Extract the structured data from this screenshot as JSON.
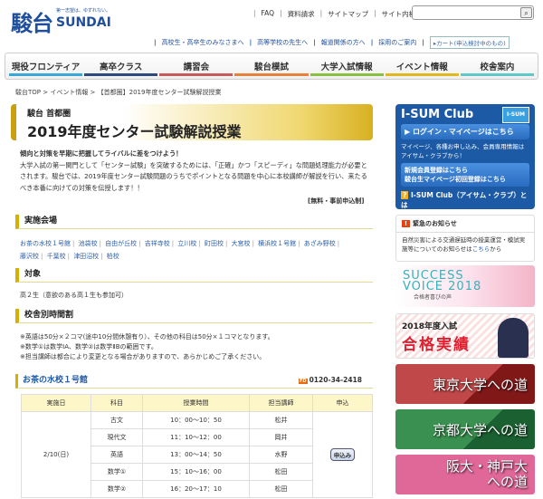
{
  "header": {
    "logo_kanji": "駿台",
    "logo_en": "SUNDAI",
    "tagline": "第一志望は、ゆずれない。",
    "top_links": [
      "FAQ",
      "資料請求",
      "サイトマップ"
    ],
    "search_label": "サイト内検索：",
    "search_value": "",
    "sub_links": [
      "高校生・高卒生のみなさまへ",
      "高等学校の先生へ",
      "報道関係の方へ",
      "採用のご案内"
    ],
    "cart": "▸カート(申込検討中のもの)"
  },
  "nav": [
    {
      "label": "現役フロンティア",
      "color": "#3ba7d8"
    },
    {
      "label": "高卒クラス",
      "color": "#2e4a7d"
    },
    {
      "label": "講習会",
      "color": "#c85a5a"
    },
    {
      "label": "駿台模試",
      "color": "#e8823a"
    },
    {
      "label": "大学入試情報",
      "color": "#8ac040"
    },
    {
      "label": "イベント情報",
      "color": "#e0b820"
    },
    {
      "label": "校舎案内",
      "color": "#5cc8c8"
    }
  ],
  "breadcrumb": "駿台TOP > イベント情報 > 【首都圏】2019年度センター試験解説授業",
  "title": {
    "sub": "駿台 首都圏",
    "main": "2019年度センター試験解説授業"
  },
  "intro": {
    "lead": "傾向と対策を早期に把握してライバルに差をつけよう！",
    "body": "大学入試の第一関門として「センター試験」を突破するためには、「正確」かつ「スピーディ」な問題処理能力が必要とされます。駿台では、2019年度センター試験問題のうちでポイントとなる問題を中心に本校講師が解説を行い、来たるべき本番に向けての対策を伝授します！！",
    "note": "[無料・事前申込制]"
  },
  "venues": {
    "heading": "実施会場",
    "items": [
      "お茶の水校１号館",
      "池袋校",
      "自由が丘校",
      "吉祥寺校",
      "立川校",
      "町田校",
      "大宮校",
      "横浜校１号館",
      "あざみ野校",
      "藤沢校",
      "千葉校",
      "津田沼校",
      "柏校"
    ]
  },
  "target": {
    "heading": "対象",
    "text": "高２生（意欲のある高１生も参加可）"
  },
  "schedule": {
    "heading": "校舎別時間割",
    "notes": [
      "※英語は50分×２コマ(途中10分間休憩有り）、その他の科目は50分×１コマとなります。",
      "※数学①は数学ⅠA、数学②は数学ⅡBの範囲です。",
      "※担当講師は都合により変更となる場合がありますので、あらかじめご了承ください。"
    ]
  },
  "campus": {
    "name": "お茶の水校１号館",
    "tel_icon": "FD",
    "tel": "0120-34-2418",
    "columns": [
      "実施日",
      "科目",
      "授業時間",
      "担当講師",
      "申込"
    ],
    "date": "2/10(日)",
    "apply": "申込み",
    "rows": [
      {
        "subject": "古文",
        "time": "10：00～10：50",
        "teacher": "松井"
      },
      {
        "subject": "現代文",
        "time": "11：10～12：00",
        "teacher": "岡井"
      },
      {
        "subject": "英語",
        "time": "13：00～14：50",
        "teacher": "水野"
      },
      {
        "subject": "数学①",
        "time": "15：10～16：00",
        "teacher": "松田"
      },
      {
        "subject": "数学②",
        "time": "16：20～17：10",
        "teacher": "松田"
      }
    ]
  },
  "sidebar": {
    "isum_title": "I-SUM Club",
    "isum_logo": "I-SUM Club",
    "login": "ログイン・マイページはこちら",
    "isum_desc": "マイページ、各種お申し込み、会員専用情報はアイサム・クラブから！",
    "register1": "新規会員登録はこちら",
    "register2": "駿台生マイページ初回登録はこちら",
    "what": "I-SUM Club（アイサム・クラブ）とは",
    "notice_title": "緊急のお知らせ",
    "notice_body": "自然災害による交通遅延時の授業運営・模試実施等についてのお知らせは",
    "notice_link": "こちら",
    "notice_tail": "から",
    "success1": "SUCCESS",
    "success2": "VOICE 2018",
    "success3": "合格者喜びの声",
    "result1": "2018年度入試",
    "result2": "合格実績",
    "tokyo": "東京大学への道",
    "kyoto": "京都大学への道",
    "osaka1": "阪大・神戸大",
    "osaka2": "への道"
  }
}
